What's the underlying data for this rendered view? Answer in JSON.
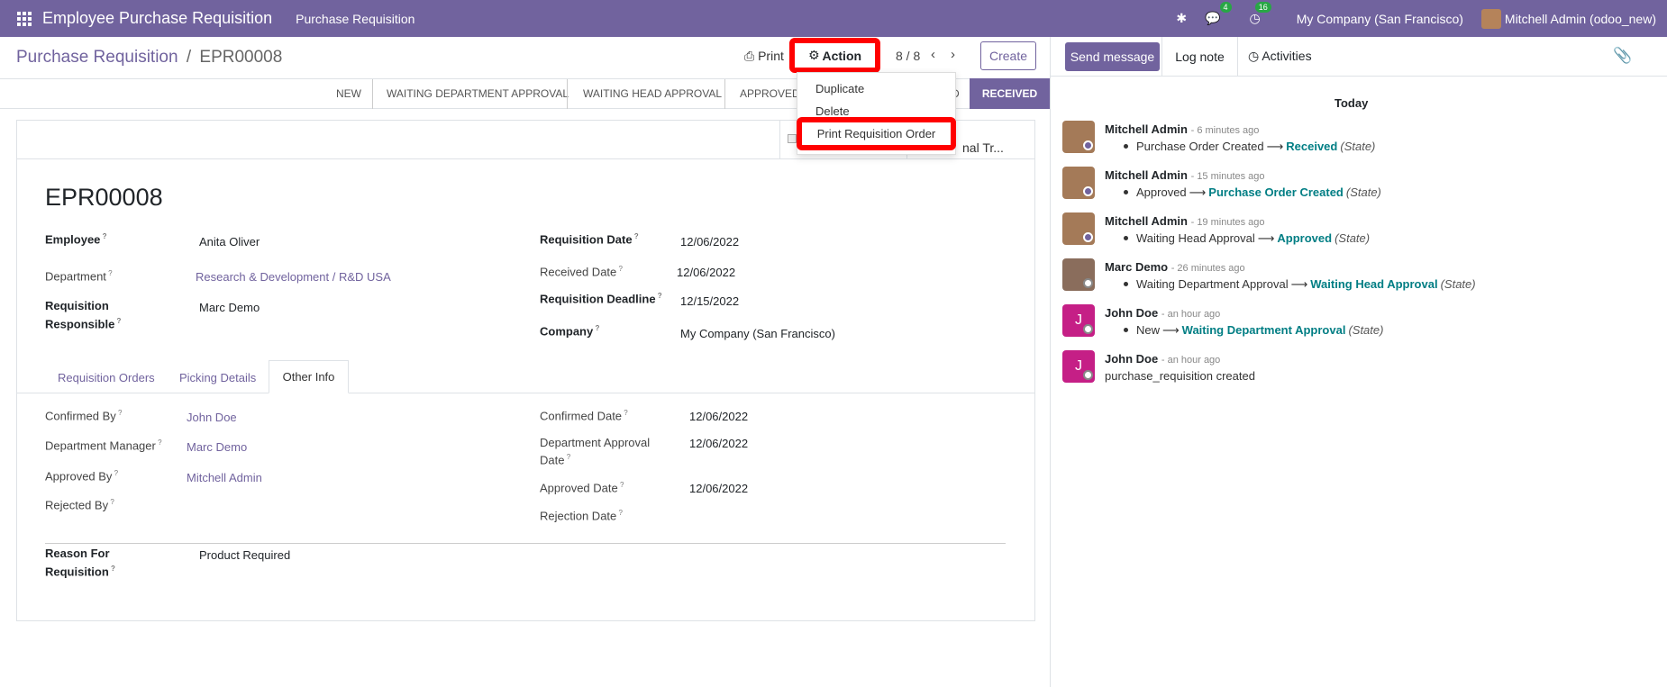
{
  "navbar": {
    "app_title": "Employee Purchase Requisition",
    "menu": "Purchase Requisition",
    "messages_count": "4",
    "activities_count": "16",
    "company": "My Company (San Francisco)",
    "user": "Mitchell Admin (odoo_new)"
  },
  "breadcrumb": {
    "parent": "Purchase Requisition",
    "current": "EPR00008"
  },
  "controls": {
    "print": "Print",
    "action": "Action",
    "pager": "8 / 8",
    "create": "Create"
  },
  "dropdown": {
    "duplicate": "Duplicate",
    "delete": "Delete",
    "print_order": "Print Requisition Order"
  },
  "statusbar": {
    "steps": [
      "NEW",
      "WAITING DEPARTMENT APPROVAL",
      "WAITING HEAD APPROVAL",
      "APPROVED",
      "D"
    ],
    "active": "RECEIVED"
  },
  "smart_button": "nal Tr...",
  "record": {
    "title": "EPR00008",
    "employee_label": "Employee",
    "employee": "Anita Oliver",
    "department_label": "Department",
    "department": "Research & Development / R&D USA",
    "responsible_label_1": "Requisition",
    "responsible_label_2": "Responsible",
    "responsible": "Marc Demo",
    "req_date_label": "Requisition Date",
    "req_date": "12/06/2022",
    "received_date_label": "Received Date",
    "received_date": "12/06/2022",
    "deadline_label": "Requisition Deadline",
    "deadline": "12/15/2022",
    "company_label": "Company",
    "company": "My Company (San Francisco)"
  },
  "tabs": {
    "orders": "Requisition Orders",
    "picking": "Picking Details",
    "other": "Other Info"
  },
  "other_info": {
    "confirmed_by_label": "Confirmed By",
    "confirmed_by": "John Doe",
    "dept_manager_label": "Department Manager",
    "dept_manager": "Marc Demo",
    "approved_by_label": "Approved By",
    "approved_by": "Mitchell Admin",
    "rejected_by_label": "Rejected By",
    "confirmed_date_label": "Confirmed Date",
    "confirmed_date": "12/06/2022",
    "dept_approval_label_1": "Department Approval",
    "dept_approval_label_2": "Date",
    "dept_approval_date": "12/06/2022",
    "approved_date_label": "Approved Date",
    "approved_date": "12/06/2022",
    "rejection_date_label": "Rejection Date",
    "reason_label_1": "Reason For",
    "reason_label_2": "Requisition",
    "reason": "Product Required"
  },
  "chatter": {
    "send_message": "Send message",
    "log_note": "Log note",
    "activities": "Activities",
    "today": "Today",
    "messages": [
      {
        "author": "Mitchell Admin",
        "date": "- 6 minutes ago",
        "old": "Purchase Order Created",
        "new": "Received",
        "field": "(State)"
      },
      {
        "author": "Mitchell Admin",
        "date": "- 15 minutes ago",
        "old": "Approved",
        "new": "Purchase Order Created",
        "field": "(State)"
      },
      {
        "author": "Mitchell Admin",
        "date": "- 19 minutes ago",
        "old": "Waiting Head Approval",
        "new": "Approved",
        "field": "(State)"
      },
      {
        "author": "Marc Demo",
        "date": "- 26 minutes ago",
        "old": "Waiting Department Approval",
        "new": "Waiting Head Approval",
        "field": "(State)"
      },
      {
        "author": "John Doe",
        "date": "- an hour ago",
        "old": "New",
        "new": "Waiting Department Approval",
        "field": "(State)"
      },
      {
        "author": "John Doe",
        "date": "- an hour ago",
        "body": "purchase_requisition created"
      }
    ],
    "avatar_letter": "J"
  }
}
